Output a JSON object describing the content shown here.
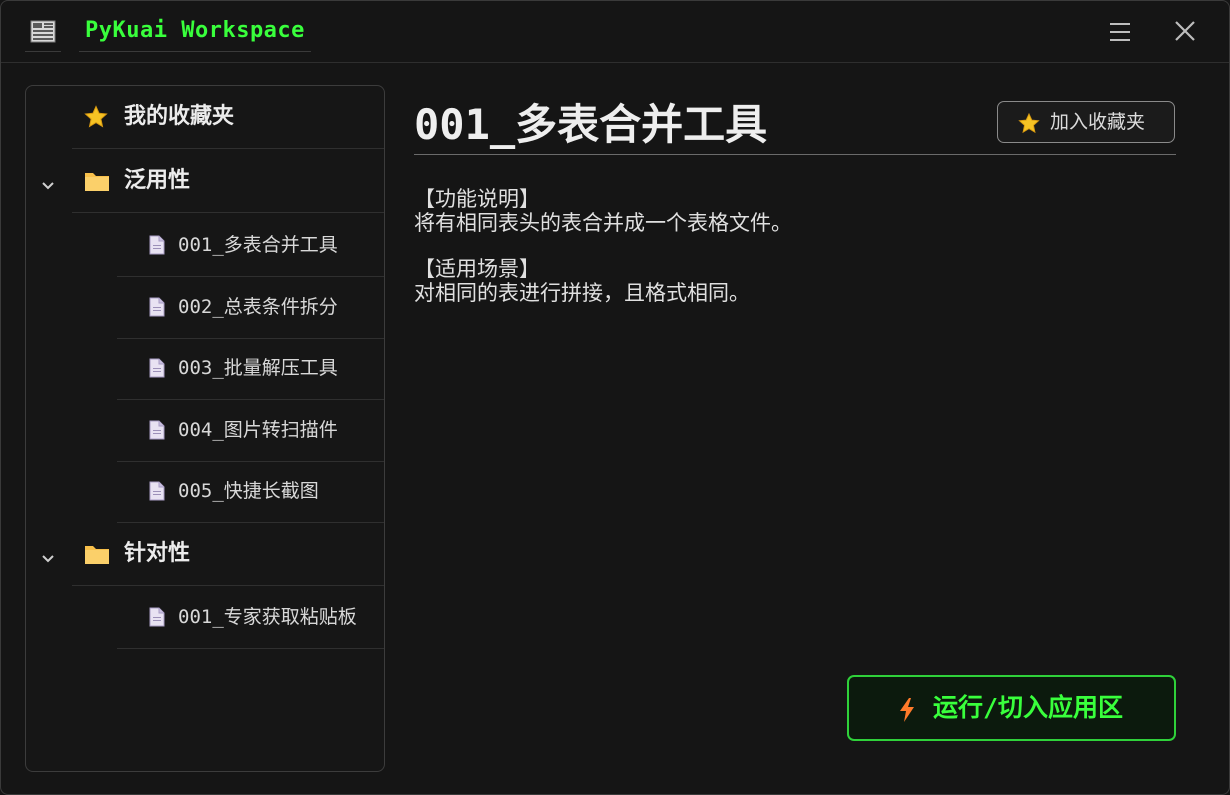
{
  "titlebar": {
    "app_title": "PyKuai Workspace",
    "app_icon": "calculator-icon",
    "menu_icon": "hamburger-menu-icon",
    "close_icon": "close-icon"
  },
  "sidebar": {
    "favorites": {
      "label": "我的收藏夹",
      "icon": "star-icon"
    },
    "groups": [
      {
        "label": "泛用性",
        "icon": "folder-icon",
        "expanded": true,
        "items": [
          {
            "label": "001_多表合并工具",
            "icon": "document-icon"
          },
          {
            "label": "002_总表条件拆分",
            "icon": "document-icon"
          },
          {
            "label": "003_批量解压工具",
            "icon": "document-icon"
          },
          {
            "label": "004_图片转扫描件",
            "icon": "document-icon"
          },
          {
            "label": "005_快捷长截图",
            "icon": "document-icon"
          }
        ]
      },
      {
        "label": "针对性",
        "icon": "folder-icon",
        "expanded": true,
        "items": [
          {
            "label": "001_专家获取粘贴板",
            "icon": "document-icon"
          }
        ]
      }
    ]
  },
  "main": {
    "title": "001_多表合并工具",
    "fav_button_label": "加入收藏夹",
    "sections": [
      {
        "heading": "【功能说明】",
        "text": "将有相同表头的表合并成一个表格文件。"
      },
      {
        "heading": "【适用场景】",
        "text": "对相同的表进行拼接，且格式相同。"
      }
    ],
    "run_button_label": "运行/切入应用区"
  },
  "colors": {
    "accent_green": "#39ff3c",
    "background": "#151515",
    "star_yellow": "#f6c324",
    "folder_yellow": "#f8c04b",
    "bolt_orange": "#ff7a2a"
  }
}
